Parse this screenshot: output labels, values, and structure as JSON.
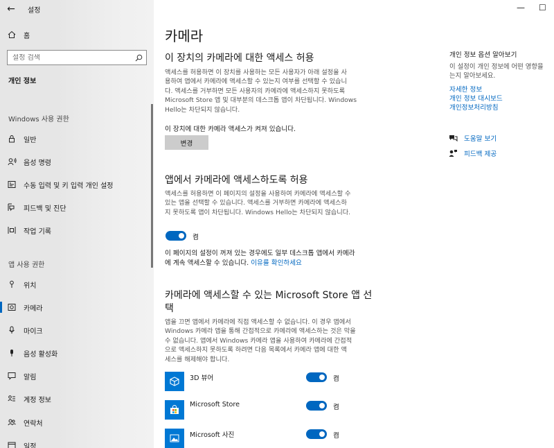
{
  "window": {
    "title": "설정",
    "back_glyph": "←",
    "minimize_glyph": "—",
    "maximize_glyph": "☐"
  },
  "sidebar": {
    "home_label": "홈",
    "search_placeholder": "설정 검색",
    "category_title": "개인 정보",
    "section_windows": "Windows 사용 권한",
    "windows_items": [
      {
        "label": "일반",
        "icon": "lock-icon"
      },
      {
        "label": "음성 명령",
        "icon": "voice-icon"
      },
      {
        "label": "수동 입력 및 키 입력 개인 설정",
        "icon": "inking-icon"
      },
      {
        "label": "피드백 및 진단",
        "icon": "feedback-diagnostics-icon"
      },
      {
        "label": "작업 기록",
        "icon": "activity-history-icon"
      }
    ],
    "section_app": "앱 사용 권한",
    "app_items": [
      {
        "label": "위치",
        "icon": "location-icon"
      },
      {
        "label": "카메라",
        "icon": "camera-icon",
        "active": true
      },
      {
        "label": "마이크",
        "icon": "microphone-icon"
      },
      {
        "label": "음성 활성화",
        "icon": "voice-activation-icon"
      },
      {
        "label": "알림",
        "icon": "notification-icon"
      },
      {
        "label": "계정 정보",
        "icon": "account-info-icon"
      },
      {
        "label": "연락처",
        "icon": "contacts-icon"
      },
      {
        "label": "일정",
        "icon": "calendar-icon"
      }
    ]
  },
  "main": {
    "title": "카메라",
    "device_heading": "이 장치의 카메라에 대한 액세스 허용",
    "device_desc_lines": [
      "액세스를 허용하면 이 장치를 사용하는 모든 사용자가 아래 설정을 사",
      "용하여 앱에서 카메라에 액세스할 수 있는지 여부를 선택할 수 있습니",
      "다. 액세스를 거부하면 모든 사용자의 카메라에 액세스하지 못하도록",
      "Microsoft Store 앱 및 대부분의 데스크톱 앱이 차단됩니다. Windows",
      "Hello는 차단되지 않습니다."
    ],
    "device_status": "이 장치에 대한 카메라 액세스가 켜져 있습니다.",
    "change_button": "변경",
    "apps_heading": "앱에서 카메라에 액세스하도록 허용",
    "apps_desc_lines": [
      "액세스를 허용하면 이 페이지의 설정을 사용하여 카메라에 액세스할 수",
      "있는 앱을 선택할 수 있습니다. 액세스를 거부하면 카메라에 액세스하",
      "지 못하도록 앱이 차단됩니다. Windows Hello는 차단되지 않습니다."
    ],
    "apps_toggle_label": "켬",
    "desktop_note_line1": "이 페이지의 설정이 꺼져 있는 경우에도 일부 데스크톱 앱에서 카메라",
    "desktop_note_line2_prefix": "에 계속 액세스할 수 있습니다. ",
    "desktop_note_link": "이유를 확인하세요",
    "store_heading_line1": "카메라에 액세스할 수 있는 Microsoft Store 앱 선",
    "store_heading_line2": "택",
    "store_desc_lines": [
      "앱을 끄면 앱에서 카메라에 직접 액세스할 수 없습니다. 이 경우 앱에서",
      "Windows 카메라 앱을 통해 간접적으로 카메라에 액세스하는 것은 막을",
      "수 없습니다. 앱에서 Windows 카메라 앱을 사용하여 카메라에 간접적",
      "으로 액세스하지 못하도록 하려면 다음 목록에서 카메라 앱에 대한 액",
      "세스를 해제해야 합니다."
    ],
    "store_apps": [
      {
        "name": "3D 뷰어",
        "state": "켬",
        "icon": "3d-viewer-icon"
      },
      {
        "name": "Microsoft Store",
        "state": "켬",
        "icon": "microsoft-store-icon"
      },
      {
        "name": "Microsoft 사진",
        "state": "켬",
        "icon": "photos-icon"
      }
    ]
  },
  "right_panel": {
    "title": "개인 정보 옵션 알아보기",
    "desc_line1": "이 설정이 개인 정보에 어떤 영향을",
    "desc_line2": "는지 알아보세요.",
    "links": [
      "자세한 정보",
      "개인 정보 대시보드",
      "개인정보처리방침"
    ],
    "help_label": "도움말 보기",
    "feedback_label": "피드백 제공"
  },
  "colors": {
    "accent": "#0067c0",
    "sidebar_bg": "#e6e6e6",
    "tile_blue": "#0078d4"
  }
}
